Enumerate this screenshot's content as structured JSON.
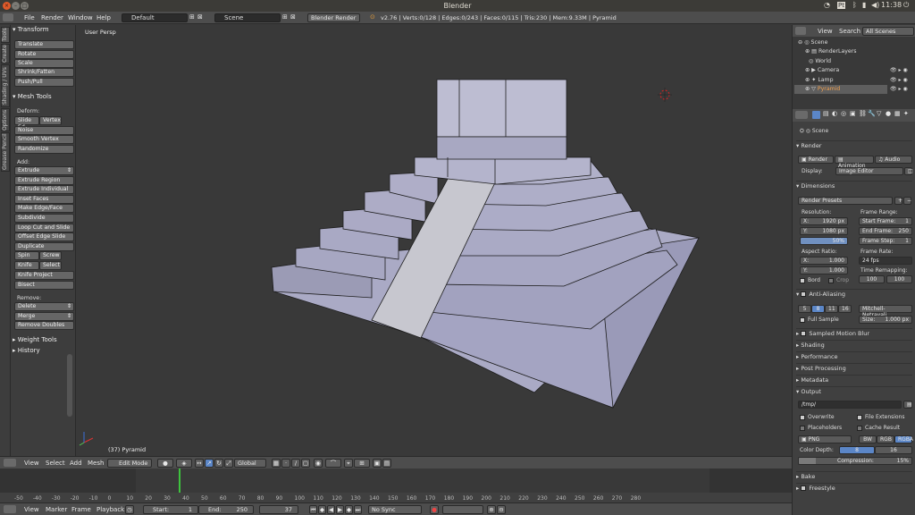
{
  "window": {
    "title": "Blender"
  },
  "tray": {
    "kb": "Pt",
    "time": "11:38"
  },
  "menu": {
    "file": "File",
    "render": "Render",
    "window": "Window",
    "help": "Help"
  },
  "screen_layout": "Default",
  "scene": "Scene",
  "engine": "Blender Render",
  "stats": "v2.76 | Verts:0/128 | Edges:0/243 | Faces:0/115 | Tris:230 | Mem:9.33M | Pyramid",
  "tabs": [
    "Tools",
    "Create",
    "Shading / UVs",
    "Options",
    "Grease Pencil"
  ],
  "toolshelf": {
    "transform": "Transform",
    "translate": "Translate",
    "rotate": "Rotate",
    "scale": "Scale",
    "shrink": "Shrink/Fatten",
    "push": "Push/Pull",
    "mesh_tools": "Mesh Tools",
    "deform": "Deform:",
    "slide_edge": "Slide Ed",
    "vertex": "Vertex",
    "noise": "Noise",
    "smooth_vertex": "Smooth Vertex",
    "randomize": "Randomize",
    "add": "Add:",
    "extrude": "Extrude",
    "extrude_region": "Extrude Region",
    "extrude_individual": "Extrude Individual",
    "inset": "Inset Faces",
    "make_edge": "Make Edge/Face",
    "subdivide": "Subdivide",
    "loop_cut": "Loop Cut and Slide",
    "offset_edge": "Offset Edge Slide",
    "duplicate": "Duplicate",
    "spin": "Spin",
    "screw": "Screw",
    "knife": "Knife",
    "select": "Select",
    "knife_project": "Knife Project",
    "bisect": "Bisect",
    "remove": "Remove:",
    "delete": "Delete",
    "merge": "Merge",
    "remove_doubles": "Remove Doubles",
    "weight_tools": "Weight Tools",
    "history": "History"
  },
  "viewport": {
    "view_label": "User Persp",
    "object_label": "(37) Pyramid"
  },
  "view_header": {
    "view": "View",
    "select": "Select",
    "add": "Add",
    "mesh": "Mesh",
    "mode": "Edit Mode",
    "orientation": "Global"
  },
  "timeline": {
    "ticks": [
      "-50",
      "-40",
      "-30",
      "-20",
      "-10",
      "0",
      "10",
      "20",
      "30",
      "40",
      "50",
      "60",
      "70",
      "80",
      "90",
      "100",
      "110",
      "120",
      "130",
      "140",
      "150",
      "160",
      "170",
      "180",
      "190",
      "200",
      "210",
      "220",
      "230",
      "240",
      "250",
      "260",
      "270",
      "280"
    ],
    "current_frame": 37,
    "footer": {
      "view": "View",
      "marker": "Marker",
      "frame": "Frame",
      "playback": "Playback",
      "start_label": "Start:",
      "start": "1",
      "end_label": "End:",
      "end": "250",
      "frame_val": "37",
      "sync": "No Sync"
    }
  },
  "outliner": {
    "view": "View",
    "search": "Search",
    "all_scenes": "All Scenes",
    "items": [
      "Scene",
      "RenderLayers",
      "World",
      "Camera",
      "Lamp",
      "Pyramid"
    ]
  },
  "properties": {
    "scene": "Scene",
    "render": "Render",
    "render_btn": "Render",
    "animation_btn": "Animation",
    "audio_btn": "Audio",
    "display_label": "Display:",
    "display": "Image Editor",
    "dimensions": "Dimensions",
    "presets": "Render Presets",
    "resolution": "Resolution:",
    "res_x_label": "X:",
    "res_x": "1920 px",
    "res_y_label": "Y:",
    "res_y": "1080 px",
    "res_pct": "50%",
    "frame_range": "Frame Range:",
    "start_frame_label": "Start Frame:",
    "start_frame": "1",
    "end_frame_label": "End Frame:",
    "end_frame": "250",
    "frame_step_label": "Frame Step:",
    "frame_step": "1",
    "aspect": "Aspect Ratio:",
    "asp_x_label": "X:",
    "asp_x": "1.000",
    "asp_y_label": "Y:",
    "asp_y": "1.000",
    "frame_rate": "Frame Rate:",
    "fps": "24 fps",
    "time_remap": "Time Remapping:",
    "remap_old": "100",
    "remap_new": "100",
    "bord": "Bord",
    "crop": "Crop",
    "anti_aliasing": "Anti-Aliasing",
    "aa_5": "5",
    "aa_8": "8",
    "aa_11": "11",
    "aa_16": "16",
    "aa_filter": "Mitchell-Netravali",
    "full_sample": "Full Sample",
    "size_label": "Size:",
    "size": "1.000 px",
    "motion_blur": "Sampled Motion Blur",
    "shading": "Shading",
    "performance": "Performance",
    "post_processing": "Post Processing",
    "metadata": "Metadata",
    "output": "Output",
    "output_path": "/tmp/",
    "overwrite": "Overwrite",
    "file_ext": "File Extensions",
    "placeholders": "Placeholders",
    "cache_result": "Cache Result",
    "format": "PNG",
    "bw": "BW",
    "rgb": "RGB",
    "rgba": "RGBA",
    "color_depth": "Color Depth:",
    "depth_8": "8",
    "depth_16": "16",
    "compression_label": "Compression:",
    "compression": "15%",
    "bake": "Bake",
    "freestyle": "Freestyle"
  }
}
